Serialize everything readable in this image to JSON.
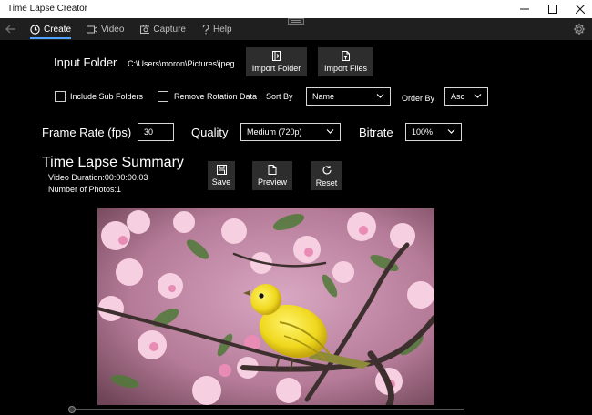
{
  "app": {
    "title": "Time Lapse Creator"
  },
  "nav": {
    "tabs": [
      {
        "label": "Create",
        "icon": "clock-icon",
        "active": true
      },
      {
        "label": "Video",
        "icon": "video-icon",
        "active": false
      },
      {
        "label": "Capture",
        "icon": "camera-icon",
        "active": false
      },
      {
        "label": "Help",
        "icon": "question-icon",
        "active": false
      }
    ]
  },
  "input": {
    "label": "Input Folder",
    "path": "C:\\Users\\moron\\Pictures\\jpeg",
    "import_folder": "Import Folder",
    "import_files": "Import Files"
  },
  "options": {
    "include_sub": "Include Sub Folders",
    "remove_rotation": "Remove Rotation Data",
    "sort_by_label": "Sort By",
    "sort_by_value": "Name",
    "order_by_label": "Order By",
    "order_by_value": "Asc"
  },
  "settings": {
    "frame_rate_label": "Frame Rate (fps)",
    "frame_rate_value": "30",
    "quality_label": "Quality",
    "quality_value": "Medium (720p)",
    "bitrate_label": "Bitrate",
    "bitrate_value": "100%"
  },
  "summary": {
    "title": "Time Lapse Summary",
    "duration": "Video Duration:00:00:00.03",
    "photos": "Number of Photos:1"
  },
  "actions": {
    "save": "Save",
    "preview": "Preview",
    "reset": "Reset"
  },
  "playback": {
    "progress": 0
  },
  "colors": {
    "accent": "#4ea3ff",
    "background": "#000000",
    "button": "#2d2d2d"
  }
}
